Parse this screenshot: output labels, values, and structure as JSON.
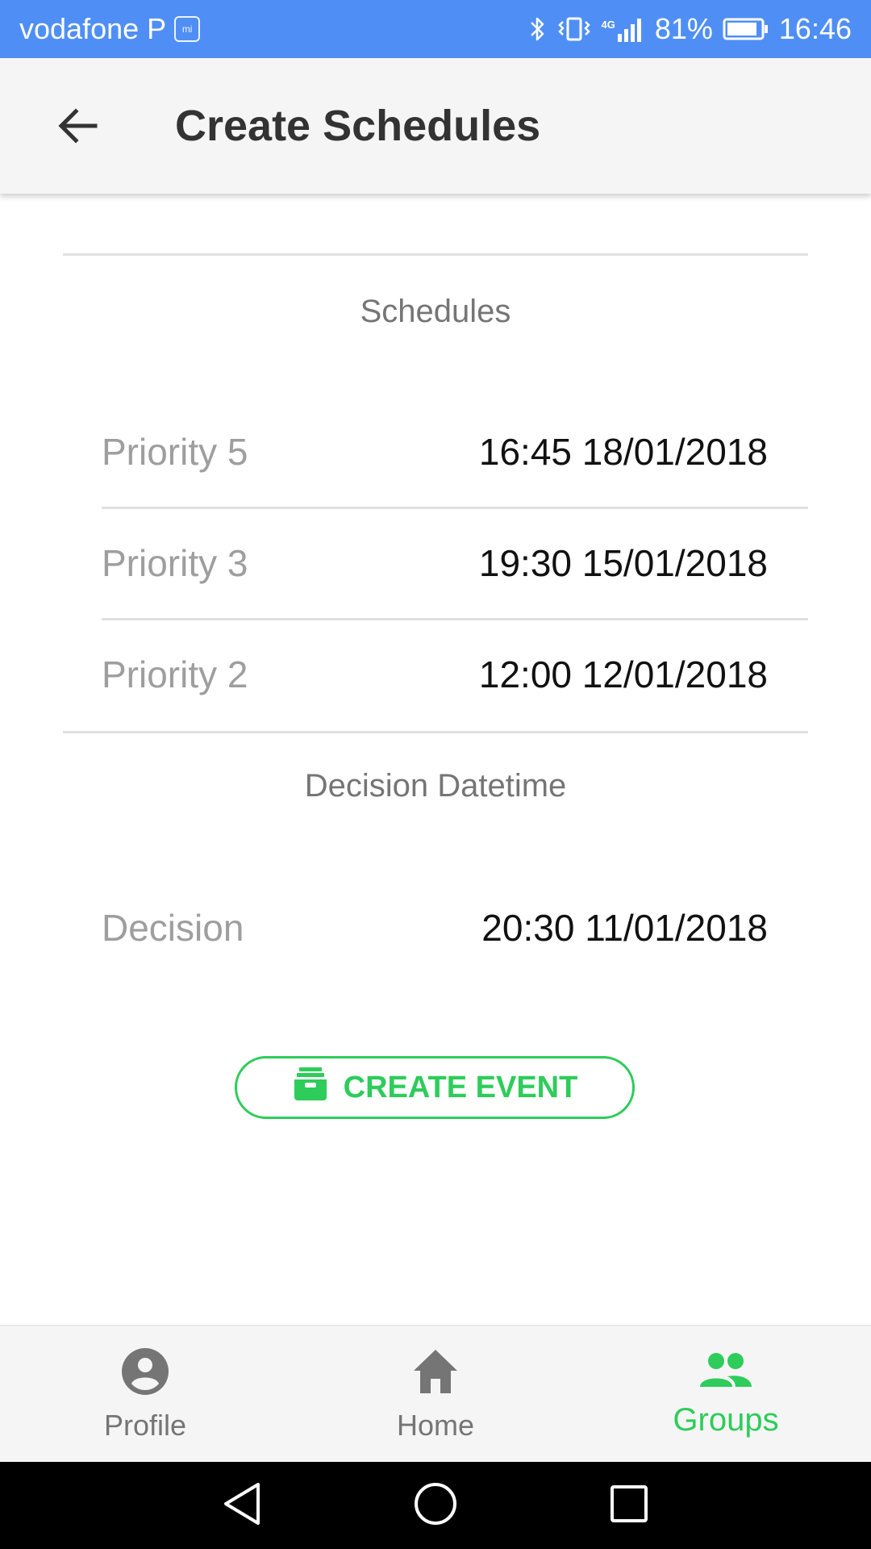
{
  "status_bar": {
    "carrier": "vodafone P",
    "carrier_badge": "mi",
    "network": "4G",
    "battery": "81%",
    "time": "16:46"
  },
  "app_bar": {
    "title": "Create Schedules"
  },
  "schedules": {
    "section_label": "Schedules",
    "items": [
      {
        "label": "Priority 5",
        "value": "16:45 18/01/2018"
      },
      {
        "label": "Priority 3",
        "value": "19:30 15/01/2018"
      },
      {
        "label": "Priority 2",
        "value": "12:00 12/01/2018"
      }
    ]
  },
  "decision": {
    "section_label": "Decision Datetime",
    "label": "Decision",
    "value": "20:30 11/01/2018"
  },
  "create_event": {
    "label": "CREATE EVENT",
    "icon": "inbox-archive-icon"
  },
  "bottom_nav": {
    "items": [
      {
        "label": "Profile",
        "icon": "account-circle-icon",
        "active": false
      },
      {
        "label": "Home",
        "icon": "home-icon",
        "active": false
      },
      {
        "label": "Groups",
        "icon": "group-icon",
        "active": true
      }
    ]
  },
  "colors": {
    "status_bar": "#4f8ff5",
    "accent": "#2ecc5a",
    "app_bar_bg": "#f5f5f5",
    "divider": "#e0e0e0"
  },
  "system_nav": {
    "icons": [
      "back-triangle-icon",
      "home-circle-icon",
      "recents-square-icon"
    ]
  }
}
